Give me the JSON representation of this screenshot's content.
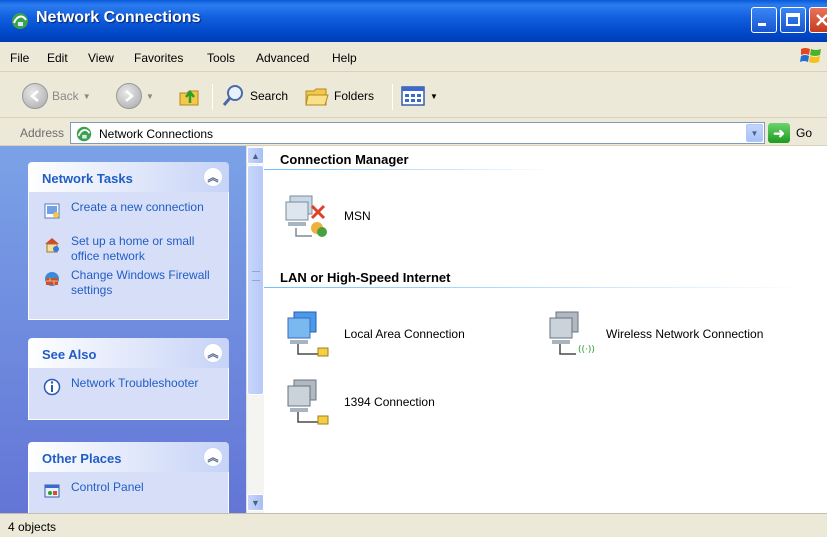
{
  "window": {
    "title": "Network Connections"
  },
  "menu": [
    "File",
    "Edit",
    "View",
    "Favorites",
    "Tools",
    "Advanced",
    "Help"
  ],
  "toolbar": {
    "back_label": "Back",
    "search_label": "Search",
    "folders_label": "Folders"
  },
  "address": {
    "label": "Address",
    "value": "Network Connections",
    "go_label": "Go"
  },
  "left_pane": {
    "network_tasks": {
      "title": "Network Tasks",
      "items": [
        {
          "label": "Create a new connection",
          "icon": "new-connection-icon"
        },
        {
          "label": "Set up a home or small office network",
          "icon": "home-network-icon"
        },
        {
          "label": "Change Windows Firewall settings",
          "icon": "firewall-icon"
        }
      ]
    },
    "see_also": {
      "title": "See Also",
      "items": [
        {
          "label": "Network Troubleshooter",
          "icon": "info-icon"
        }
      ]
    },
    "other_places": {
      "title": "Other Places",
      "items": [
        {
          "label": "Control Panel",
          "icon": "control-panel-icon"
        }
      ]
    }
  },
  "content": {
    "groups": [
      {
        "title": "Connection Manager",
        "items": [
          {
            "label": "MSN",
            "icon": "msn-connection-icon"
          }
        ]
      },
      {
        "title": "LAN or High-Speed Internet",
        "items": [
          {
            "label": "Local Area Connection",
            "icon": "lan-connection-icon"
          },
          {
            "label": "Wireless Network Connection",
            "icon": "wireless-connection-icon"
          },
          {
            "label": "1394 Connection",
            "icon": "lan-connection-icon"
          }
        ]
      }
    ]
  },
  "status": {
    "text": "4 objects"
  },
  "colors": {
    "titlebar": "#0A5AD8",
    "task_link": "#215DC6",
    "left_pane": "#7BA2E7",
    "panel_body": "#D6DFF7"
  }
}
